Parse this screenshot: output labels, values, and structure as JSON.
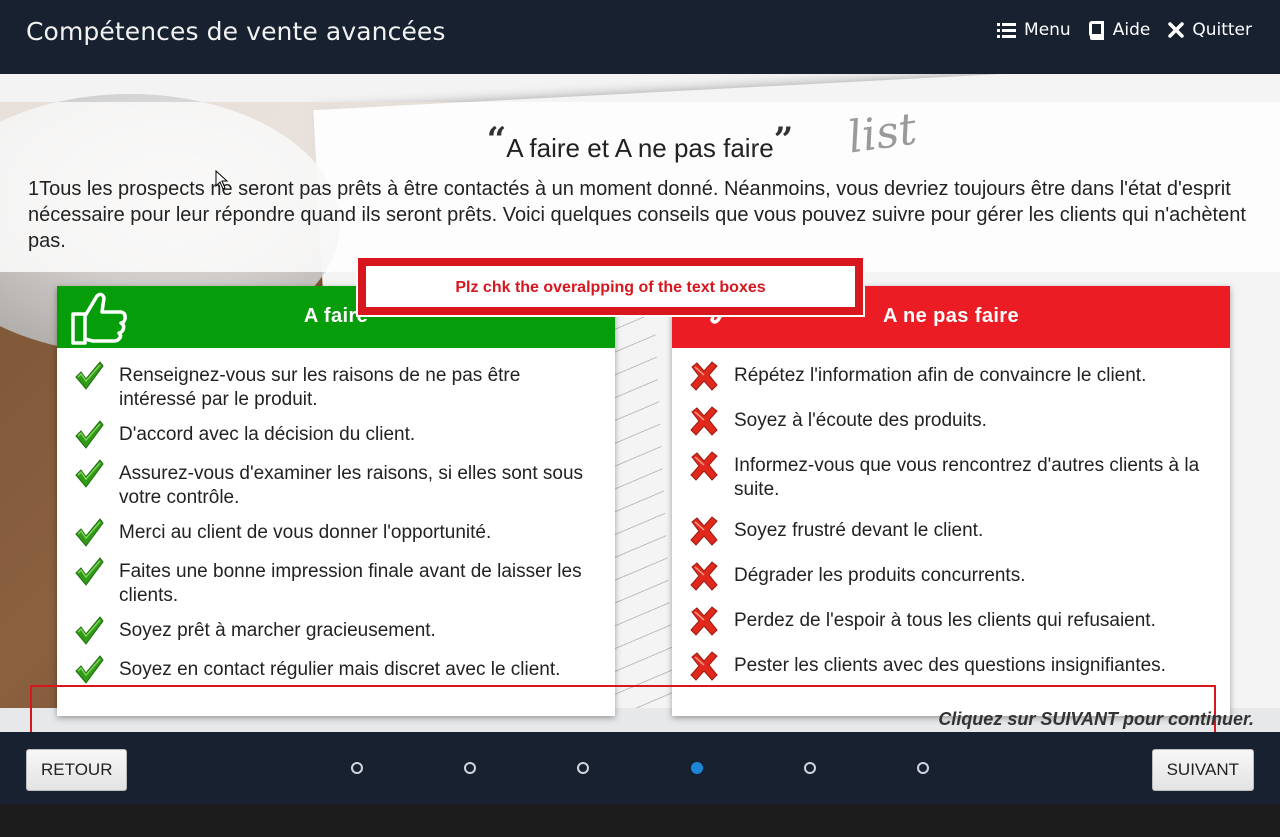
{
  "header": {
    "title": "Compétences de vente avancées",
    "menu_label": "Menu",
    "help_label": "Aide",
    "quit_label": "Quitter"
  },
  "slide": {
    "title": "A faire et A ne pas faire",
    "intro": "1Tous les prospects ne seront pas prêts à être contactés à un moment donné. Néanmoins, vous devriez toujours être dans l'état d'esprit nécessaire pour leur répondre quand ils seront prêts. Voici quelques conseils que vous pouvez suivre pour gérer les clients qui n'achètent pas.",
    "background_text": "list"
  },
  "do_card": {
    "heading": "A faire",
    "color": "#069d0a",
    "icon": "thumbs-up-icon",
    "items": [
      "Renseignez-vous sur les raisons de ne pas être intéressé par le produit.",
      "D'accord avec la décision du client.",
      "Assurez-vous d'examiner les raisons, si elles sont sous votre contrôle.",
      "Merci au client de vous donner l'opportunité.",
      "Faites une bonne impression finale avant de laisser les clients.",
      "Soyez prêt à marcher gracieusement.",
      "Soyez en contact régulier mais discret avec le client."
    ]
  },
  "dont_card": {
    "heading": "A ne pas faire",
    "color": "#ec1c24",
    "icon": "thumbs-down-icon",
    "items": [
      "Répétez l'information afin de convaincre le client.",
      "Soyez à l'écoute des produits.",
      "Informez-vous que vous rencontrez d'autres clients à la suite.",
      "Soyez frustré devant le client.",
      "Dégrader les produits concurrents.",
      "Perdez de l'espoir à tous les clients qui refusaient.",
      "Pester les clients avec des questions insignifiantes."
    ]
  },
  "review_note": {
    "text": "Plz chk the overalpping of the text boxes",
    "color": "#d8161e"
  },
  "continue_hint": "Cliquez sur SUIVANT pour continuer.",
  "footer": {
    "back_label": "RETOUR",
    "next_label": "SUIVANT",
    "page_count": 6,
    "active_page": 4,
    "active_color": "#1d86d8"
  }
}
